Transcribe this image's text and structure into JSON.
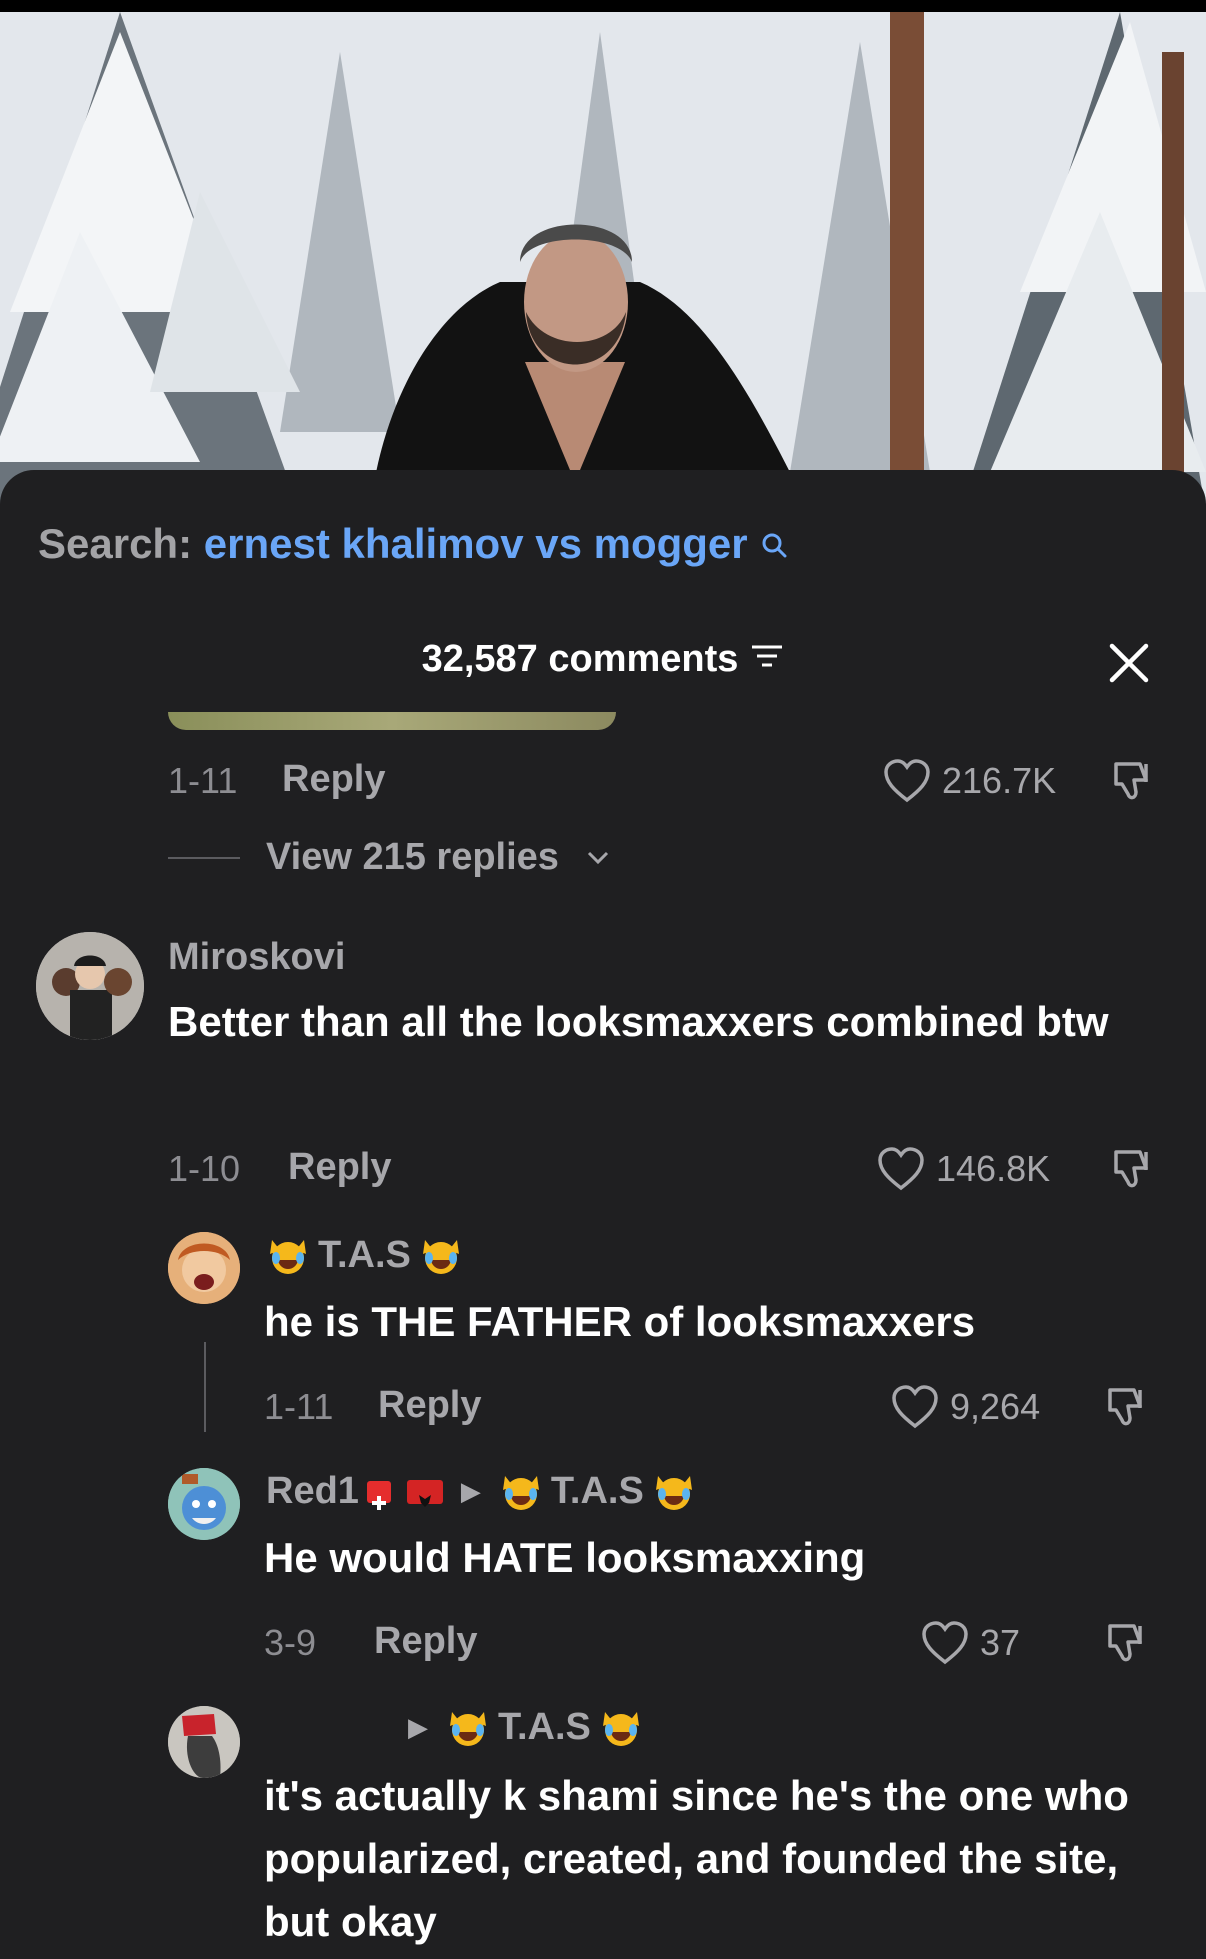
{
  "search": {
    "label": "Search:",
    "query": "ernest khalimov vs mogger"
  },
  "header": {
    "comment_count": "32,587 comments"
  },
  "top_comment": {
    "date": "1-11",
    "reply_label": "Reply",
    "likes": "216.7K",
    "view_replies": "View 215 replies"
  },
  "comments": [
    {
      "username": "Miroskovi",
      "text": "Better than all the looksmaxxers combined btw",
      "date": "1-10",
      "reply_label": "Reply",
      "likes": "146.8K"
    },
    {
      "username": "T.A.S",
      "text": "he is THE FATHER of looksmaxxers",
      "date": "1-11",
      "reply_label": "Reply",
      "likes": "9,264"
    },
    {
      "username": "Red1",
      "reply_to": "T.A.S",
      "text": "He would HATE looksmaxxing",
      "date": "3-9",
      "reply_label": "Reply",
      "likes": "37"
    },
    {
      "username": "",
      "reply_to": "T.A.S",
      "text": "it's actually k shami since he's the one who popularized, created, and founded the site, but okay"
    }
  ],
  "colors": {
    "background": "#1f1f21",
    "link": "#6aa6f7",
    "muted": "#a7a7ab",
    "text": "#ffffff"
  },
  "icons": [
    "search-icon",
    "filter-icon",
    "close-icon",
    "heart-icon",
    "dislike-icon",
    "chevron-down-icon",
    "laughing-cat-emoji",
    "swiss-flag",
    "albanian-flag",
    "reply-arrow-icon"
  ]
}
